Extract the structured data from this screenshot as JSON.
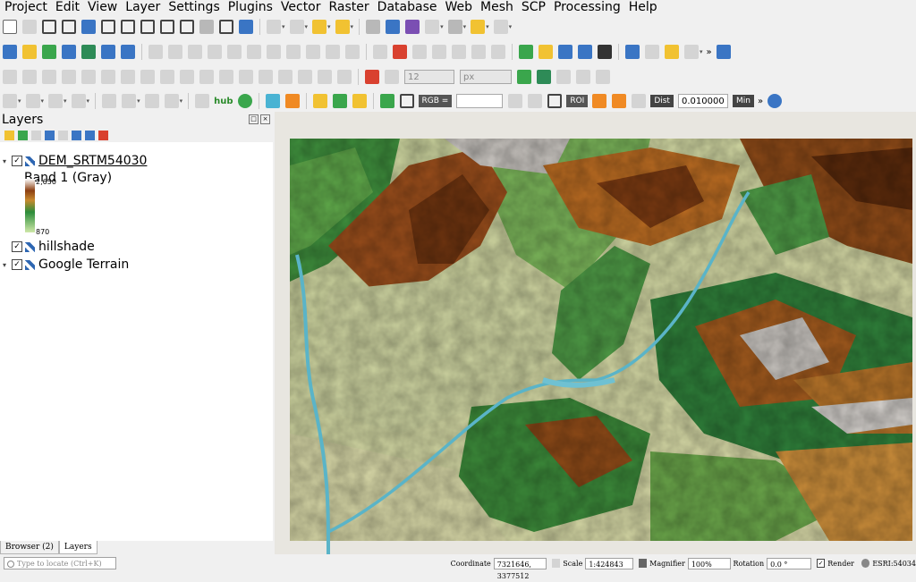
{
  "menu": [
    "Project",
    "Edit",
    "View",
    "Layer",
    "Settings",
    "Plugins",
    "Vector",
    "Raster",
    "Database",
    "Web",
    "Mesh",
    "SCP",
    "Processing",
    "Help"
  ],
  "toolbar": {
    "font_size_value": "12",
    "font_unit": "px",
    "rgb_label": "RGB =",
    "roi_label": "ROI",
    "dist_label": "Dist",
    "dist_value": "0.010000",
    "min_label": "Min",
    "hub_label": "hub"
  },
  "layers_panel": {
    "title": "Layers",
    "layers": [
      {
        "name": "DEM_SRTM54030",
        "checked": true,
        "expanded": true
      },
      {
        "name": "hillshade",
        "checked": true,
        "expanded": false
      },
      {
        "name": "Google Terrain",
        "checked": true,
        "expanded": true
      }
    ],
    "band_label": "Band 1 (Gray)",
    "legend_max": "2,650",
    "legend_min": "870"
  },
  "bottom_tabs": [
    "Browser (2)",
    "Layers"
  ],
  "status": {
    "locate_placeholder": "Type to locate (Ctrl+K)",
    "coordinate_label": "Coordinate",
    "coordinate_value": "7321646, 3377512",
    "scale_label": "Scale",
    "scale_value": "1:424843",
    "magnifier_label": "Magnifier",
    "magnifier_value": "100%",
    "rotation_label": "Rotation",
    "rotation_value": "0.0 °",
    "render_label": "Render",
    "crs_label": "ESRI:54034"
  },
  "colors": {
    "high_elev": "#ffffff",
    "mid_high": "#8c3f12",
    "mid": "#c88a2e",
    "low_mid": "#2c8c3a",
    "low": "#cfe8a8",
    "water": "#5ab4c8"
  }
}
